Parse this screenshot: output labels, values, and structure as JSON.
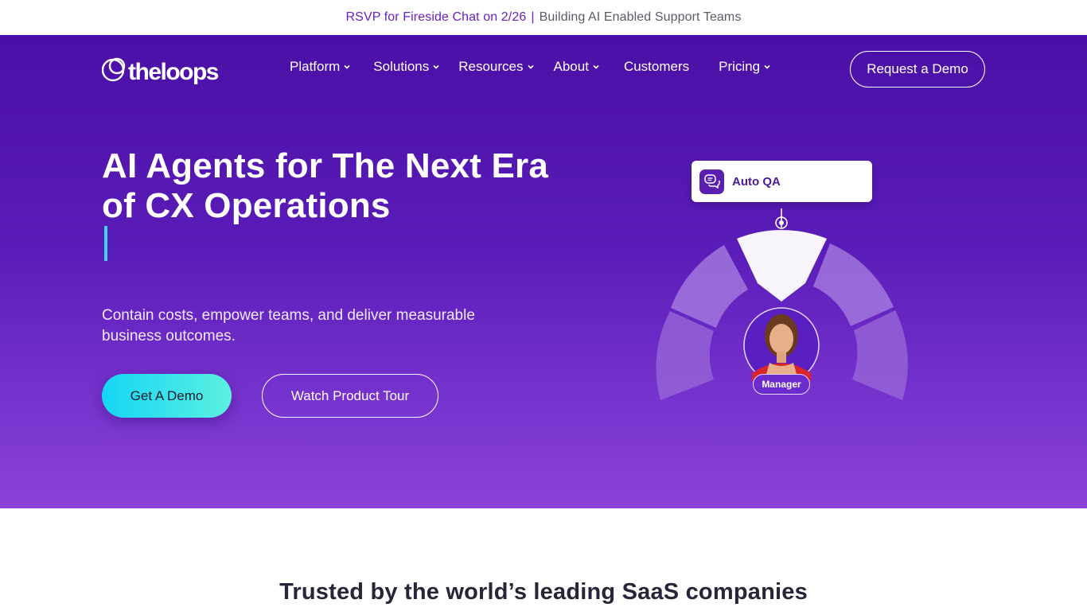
{
  "announcement": {
    "link_text": "RSVP for Fireside Chat on 2/26",
    "separator": "|",
    "text": "Building AI Enabled Support Teams"
  },
  "nav": {
    "logo_text": "theloops",
    "items": [
      {
        "label": "Platform",
        "has_dropdown": true
      },
      {
        "label": "Solutions",
        "has_dropdown": true
      },
      {
        "label": "Resources",
        "has_dropdown": true
      },
      {
        "label": "About",
        "has_dropdown": true
      },
      {
        "label": "Customers",
        "has_dropdown": false
      },
      {
        "label": "Pricing",
        "has_dropdown": true
      }
    ],
    "cta_label": "Request a Demo"
  },
  "hero": {
    "headline_line1": "AI Agents for The Next Era",
    "headline_line2": "of CX Operations",
    "subtext": "Contain costs, empower teams, and deliver measurable business outcomes.",
    "primary_button": "Get A Demo",
    "secondary_button": "Watch Product Tour"
  },
  "illustration": {
    "card_label": "Auto QA",
    "badge_label": "Manager"
  },
  "trusted": {
    "heading": "Trusted by the world’s leading SaaS companies"
  },
  "colors": {
    "brand_purple": "#4a10a6",
    "accent_cyan": "#14d6f5",
    "announce_link": "#6a1fc2"
  },
  "icons": {
    "logo": "loops-logo-icon",
    "dropdown": "chevron-down-icon",
    "card": "chat-bubbles-icon"
  }
}
